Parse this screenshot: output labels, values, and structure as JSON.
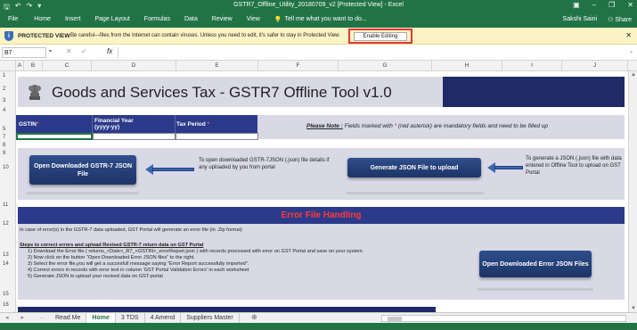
{
  "window": {
    "title": "GSTR7_Offline_Utility_20180709_v2 [Protected View] - Excel",
    "user": "Sakshi Saini",
    "share_label": "Share"
  },
  "ribbon": {
    "tabs": [
      "File",
      "Home",
      "Insert",
      "Page Layout",
      "Formulas",
      "Data",
      "Review",
      "View"
    ],
    "tell_me": "Tell me what you want to do..."
  },
  "protected_view": {
    "label": "PROTECTED VIEW",
    "message": "Be careful—files from the Internet can contain viruses. Unless you need to edit, it's safer to stay in Protected View.",
    "enable_button": "Enable Editing"
  },
  "formula_bar": {
    "name_box": "B7",
    "fx": "fx",
    "value": ""
  },
  "columns": [
    "A",
    "B",
    "C",
    "D",
    "E",
    "F",
    "G",
    "H",
    "I",
    "J"
  ],
  "rows": [
    "1",
    "2",
    "3",
    "4",
    "5",
    "7",
    "8",
    "9",
    "10",
    "11",
    "12",
    "13",
    "14",
    "15",
    "16"
  ],
  "sheet": {
    "banner_title": "Goods and Services Tax - GSTR7 Offline Tool  v1.0",
    "header": {
      "gstin": "GSTIN",
      "financial_year": "Financial Year",
      "financial_year_fmt": "(yyyy-yy)",
      "tax_period": "Tax Period",
      "asterisk": "*"
    },
    "note": {
      "label": "Please Note :",
      "text_before": "Fields marked with",
      "asterisk": "*",
      "text_after": "(red asterisk) are mandatory fields and need to be filled up"
    },
    "open_gstr7_button": "Open Downloaded GSTR-7 JSON File",
    "open_help": "To open downloaded GSTR-7JSON (.json) file details if any uploaded by you from portal",
    "generate_button": "Generate JSON File to upload",
    "generate_help": "To generate a JSON (.json) file with data entered in Offline Tool to upload on GST Portal",
    "error_title": "Error File Handling",
    "error_intro": "In case of error(s) in the GSTR-7 data uploaded, GST Portal will generate an error file (in .Zip format)",
    "steps_title": "Steps to correct errors and upload Revised GSTR-7 return data on GST Portal",
    "steps": [
      "1) Download the Error file  ( returns_<Date>_R7_<GSTIN>_errorReport.json ) with records processed with error on GST Portal and save on your system",
      "2) Now click on the button \"Open Downloaded Error JSON files\" to the right.",
      "3) Select the error file,you will get a succesfull message saying \"Error Report successfully imported\".",
      "4) Correct errors in records with error text in column 'GST Portal Validation Errors' in each worksheet",
      "5) Generate JSON to upload your revised data on GST-portal"
    ],
    "open_error_button": "Open Downloaded Error JSON Files"
  },
  "sheet_tabs": [
    "Read Me",
    "Home",
    "3 TDS",
    "4 Amend",
    "Suppliers Master"
  ],
  "active_sheet": "Home",
  "colors": {
    "excel_green": "#217346",
    "navy": "#2b3a8a",
    "band": "#d9d9e6",
    "error_red": "#ff3b3b",
    "highlight": "#e03a3a"
  }
}
